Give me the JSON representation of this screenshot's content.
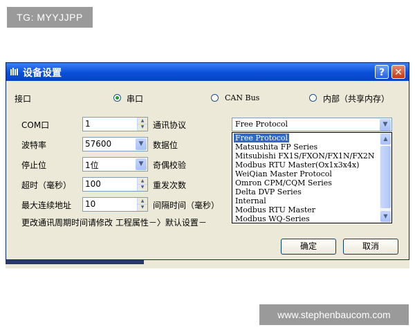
{
  "watermark_top": "TG: MYYJJPP",
  "watermark_bottom": "www.stephenbaucom.com",
  "dialog": {
    "title": "设备设置",
    "help_glyph": "?",
    "close_glyph": "✕"
  },
  "interface": {
    "label": "接口",
    "options": [
      "串口",
      "CAN Bus",
      "内部（共享内存）"
    ],
    "selected": "串口"
  },
  "fields": {
    "com_label": "COM口",
    "com_value": "1",
    "baud_label": "波特率",
    "baud_value": "57600",
    "stop_label": "停止位",
    "stop_value": "1位",
    "timeout_label": "超时（毫秒）",
    "timeout_value": "100",
    "maxaddr_label": "最大连续地址",
    "maxaddr_value": "10",
    "protocol_label": "通讯协议",
    "databits_label": "数据位",
    "parity_label": "奇偶校验",
    "retry_label": "重发次数",
    "interval_label": "间隔时间（毫秒）"
  },
  "protocol": {
    "current": "Free Protocol",
    "options": [
      "Free Protocol",
      "Matsushita FP Series",
      "Mitsubishi FX1S/FXON/FX1N/FX2N",
      "Modbus RTU Master(Ox1x3x4x)",
      "WeiQian Master Protocol",
      "Omron CPM/CQM Series",
      "Delta DVP Series",
      "Internal",
      "Modbus RTU Master",
      "Modbus WQ-Series"
    ],
    "highlighted": "Free Protocol"
  },
  "hint": "更改通讯周期时间请修改 工程属性－〉默认设置－",
  "buttons": {
    "ok": "确定",
    "cancel": "取消"
  },
  "colors": {
    "titlebar": "#0a4fd9",
    "selection": "#316ac5",
    "dialog_bg": "#ece9d8"
  }
}
